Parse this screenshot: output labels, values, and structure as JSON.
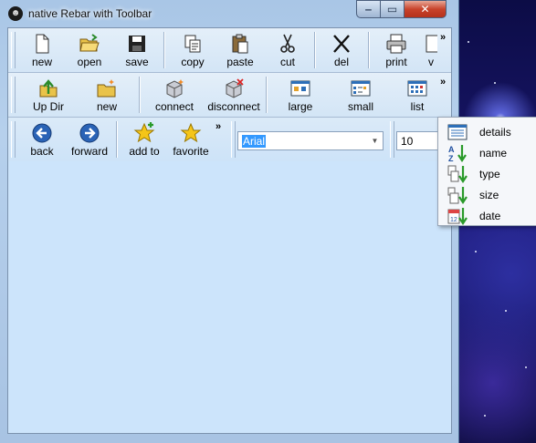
{
  "window": {
    "title": "native Rebar with Toolbar"
  },
  "band1": [
    {
      "label": "new",
      "icon": "new-file-icon"
    },
    {
      "label": "open",
      "icon": "open-folder-icon"
    },
    {
      "label": "save",
      "icon": "save-disk-icon"
    },
    {
      "label": "copy",
      "icon": "copy-icon"
    },
    {
      "label": "paste",
      "icon": "paste-icon"
    },
    {
      "label": "cut",
      "icon": "scissors-icon"
    },
    {
      "label": "del",
      "icon": "delete-x-icon"
    },
    {
      "label": "print",
      "icon": "printer-icon"
    },
    {
      "label": "v",
      "icon": "view-icon"
    }
  ],
  "band2": [
    {
      "label": "Up Dir",
      "icon": "up-dir-icon"
    },
    {
      "label": "new",
      "icon": "new-folder-icon"
    },
    {
      "label": "connect",
      "icon": "connect-icon"
    },
    {
      "label": "disconnect",
      "icon": "disconnect-icon"
    },
    {
      "label": "large",
      "icon": "large-icons-view-icon"
    },
    {
      "label": "small",
      "icon": "small-icons-view-icon"
    },
    {
      "label": "list",
      "icon": "list-view-icon"
    }
  ],
  "band3": [
    {
      "label": "back",
      "icon": "back-arrow-icon"
    },
    {
      "label": "forward",
      "icon": "forward-arrow-icon"
    },
    {
      "label": "add to",
      "icon": "add-favorite-icon"
    },
    {
      "label": "favorite",
      "icon": "favorite-star-icon"
    }
  ],
  "font_combo": {
    "value": "Arial"
  },
  "size_combo": {
    "value": "10"
  },
  "chevron": "»",
  "popup_menu": [
    {
      "label": "details",
      "icon": "details-view-icon"
    },
    {
      "label": "name",
      "icon": "sort-by-name-icon"
    },
    {
      "label": "type",
      "icon": "sort-by-type-icon"
    },
    {
      "label": "size",
      "icon": "sort-by-size-icon"
    },
    {
      "label": "date",
      "icon": "sort-by-date-icon"
    }
  ]
}
